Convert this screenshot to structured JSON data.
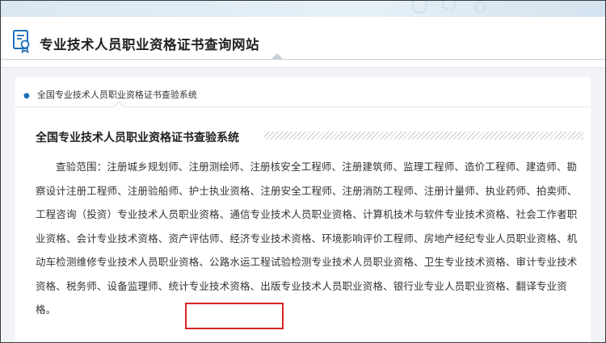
{
  "header": {
    "site_title": "专业技术人员职业资格证书查询网站",
    "icon": "certificate-icon"
  },
  "breadcrumb": {
    "text": "全国专业技术人员职业资格证书查验系统"
  },
  "section": {
    "title": "全国专业技术人员职业资格证书查验系统",
    "scope_text": "查验范围：注册城乡规划师、注册测绘师、注册核安全工程师、注册建筑师、监理工程师、造价工程师、建造师、勘察设计注册工程师、注册验船师、护士执业资格、注册安全工程师、注册消防工程师、注册计量师、执业药师、拍卖师、工程咨询（投资）专业技术人员职业资格、通信专业技术人员职业资格、计算机技术与软件专业技术资格、社会工作者职业资格、会计专业技术资格、资产评估师、经济专业技术资格、环境影响评价工程师、房地产经纪专业人员职业资格、机动车检测维修专业技术人员职业资格、公路水运工程试验检测专业技术人员职业资格、卫生专业技术资格、审计专业技术资格、税务师、设备监理师、统计专业技术资格、出版专业技术人员职业资格、银行业专业人员职业资格、翻译专业资格。"
  },
  "colors": {
    "highlight": "#d82525",
    "accent": "#1d6fb8"
  }
}
